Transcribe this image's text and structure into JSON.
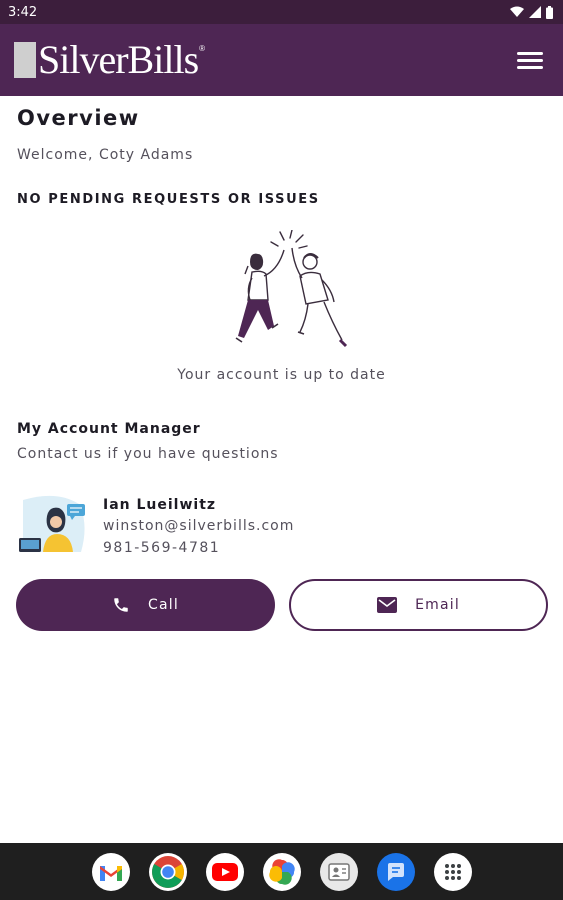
{
  "status_bar": {
    "time": "3:42"
  },
  "app_bar": {
    "logo_text": "SilverBills",
    "logo_mark": "®"
  },
  "overview": {
    "title": "Overview",
    "welcome": "Welcome, Coty Adams",
    "section_heading": "NO PENDING REQUESTS OR ISSUES",
    "status_text": "Your account is up to date"
  },
  "account_manager": {
    "title": "My Account Manager",
    "subtitle": "Contact us if you have questions",
    "name": "Ian Lueilwitz",
    "email": "winston@silverbills.com",
    "phone": "981-569-4781"
  },
  "actions": {
    "call_label": "Call",
    "email_label": "Email"
  },
  "dock": {
    "apps": [
      "gmail-icon",
      "chrome-icon",
      "youtube-icon",
      "photos-icon",
      "contacts-icon",
      "messages-icon",
      "app-drawer-icon"
    ]
  },
  "colors": {
    "brand": "#4e2654",
    "status_bar": "#3c1e3c",
    "dock": "#1f1f1f"
  }
}
